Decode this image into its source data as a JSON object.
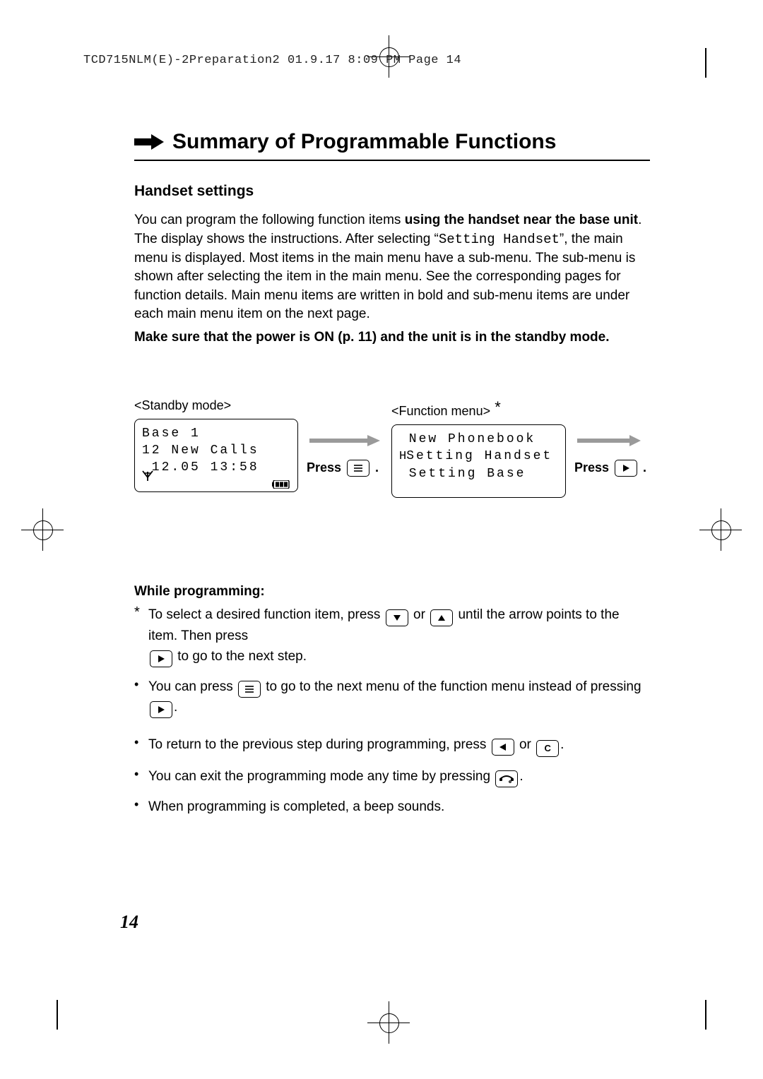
{
  "header": "TCD715NLM(E)-2Preparation2  01.9.17 8:09 PM  Page 14",
  "title": "Summary of Programmable Functions",
  "subhead": "Handset settings",
  "intro": {
    "p1a": "You can program the following function items ",
    "p1b": "using the handset near the base unit",
    "p1c": ". The display shows the instructions. After selecting “",
    "p1d": "Setting Handset",
    "p1e": "”, the main menu is displayed. Most items in the main menu have a sub-menu. The sub-menu is shown after selecting the item in the main menu. See the corresponding pages for function details. Main menu items are written in bold and sub-menu items are under each main menu item on the next page.",
    "p2": "Make sure that the power is ON (p. 11) and the unit is in the standby mode."
  },
  "screens": {
    "standby": {
      "label": "<Standby mode>",
      "line1": "Base 1",
      "line2": "12 New Calls",
      "line3": " 12.05 13:58",
      "press": "Press"
    },
    "function": {
      "label": "<Function menu>",
      "line1": " New Phonebook",
      "line2": "Setting Handset",
      "line3": " Setting Base",
      "press": "Press"
    }
  },
  "notes": {
    "head": "While programming:",
    "n1a": "To select a desired function item, press ",
    "n1b": " or ",
    "n1c": " until the arrow points to the item. Then press ",
    "n1d": " to go to the next step.",
    "n2a": "You can press ",
    "n2b": " to go to the next menu of the function menu instead of pressing ",
    "n2c": ".",
    "n3a": "To return to the previous step during programming, press ",
    "n3b": " or ",
    "n3c": ".",
    "n4a": "You can exit the programming mode any time by pressing ",
    "n4b": ".",
    "n5": "When programming is completed, a beep sounds."
  },
  "page_number": "14",
  "icons": {
    "c_button": "C"
  }
}
